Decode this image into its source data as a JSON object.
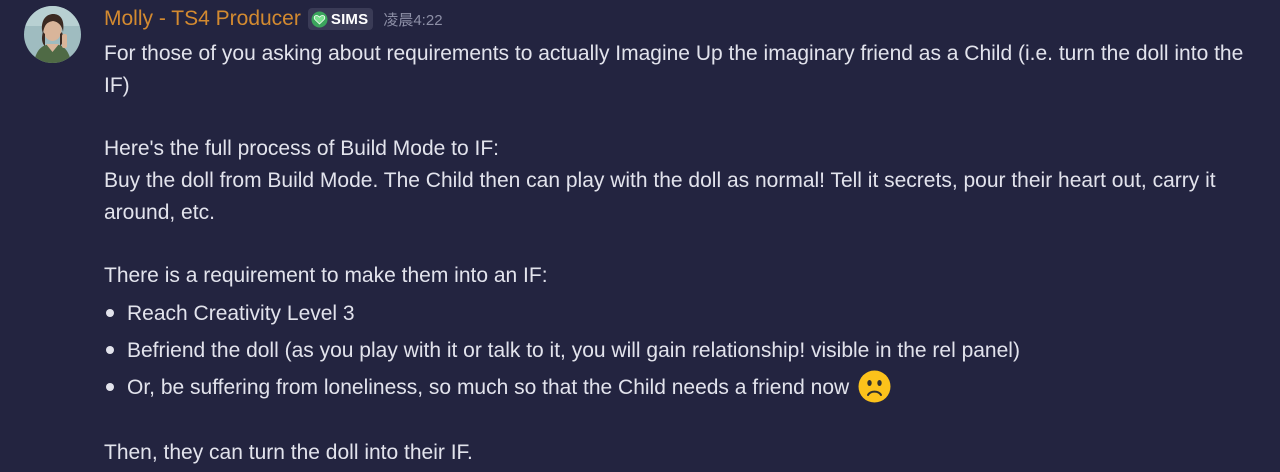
{
  "message": {
    "author": "Molly - TS4 Producer",
    "role_tag": {
      "label": "SIMS",
      "icon": "green-heart-icon",
      "color": "#3ba55c"
    },
    "timestamp": "凌晨4:22",
    "author_color": "#d38a30",
    "paragraphs": {
      "p1": "For those of you asking about requirements to actually Imagine Up the imaginary friend as a Child (i.e. turn the doll into the IF)",
      "p2": "Here's the full process of Build Mode to IF:",
      "p3": "Buy the doll from Build Mode. The Child then can play with the doll as normal! Tell it secrets, pour their heart out, carry it around, etc.",
      "p4": "There is a requirement to make them into an IF:",
      "p5": "Then, they can turn the doll into their IF."
    },
    "bullets": [
      "Reach Creativity Level 3",
      "Befriend the doll (as you play with it or talk to it, you will gain relationship! visible in the rel panel)",
      "Or, be suffering from loneliness, so much so that the Child needs a friend now"
    ],
    "emoji": "slightly-frowning-face-icon"
  }
}
